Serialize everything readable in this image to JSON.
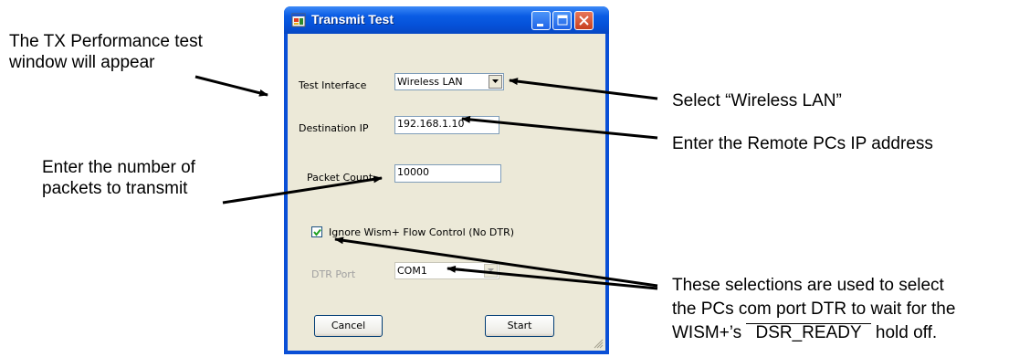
{
  "window": {
    "title": "Transmit Test"
  },
  "form": {
    "test_interface_label": "Test Interface",
    "test_interface_value": "Wireless LAN",
    "destination_ip_label": "Destination IP",
    "destination_ip_value": "192.168.1.10",
    "packet_count_label": "Packet Count",
    "packet_count_value": "10000",
    "ignore_flow_label": "Ignore Wism+ Flow Control  (No DTR)",
    "ignore_flow_checked": true,
    "dtr_port_label": "DTR Port",
    "dtr_port_value": "COM1",
    "cancel_label": "Cancel",
    "start_label": "Start"
  },
  "annotations": {
    "left_top_line1": "The TX Performance test",
    "left_top_line2": "window will appear",
    "left_mid_line1": "Enter the number of",
    "left_mid_line2": "packets to transmit",
    "right_select": "Select “Wireless LAN”",
    "right_ip": "Enter the Remote PCs IP address",
    "right_bottom_line1": "These selections are used to select",
    "right_bottom_line2": "the PCs com port DTR to wait for the",
    "right_bottom_line3_prefix": "WISM+’s",
    "right_bottom_line3_overlined": "DSR_READY",
    "right_bottom_line3_suffix": "hold off."
  },
  "colors": {
    "titlebar_blue": "#0551d8",
    "dialog_face": "#ece9d8",
    "close_red": "#c8401f"
  },
  "icons": {
    "title": "app-window-icon",
    "minimize": "minimize-icon",
    "maximize": "maximize-icon",
    "close": "close-icon",
    "dropdown": "chevron-down-icon",
    "check": "check-icon",
    "grip": "resize-grip-icon"
  }
}
